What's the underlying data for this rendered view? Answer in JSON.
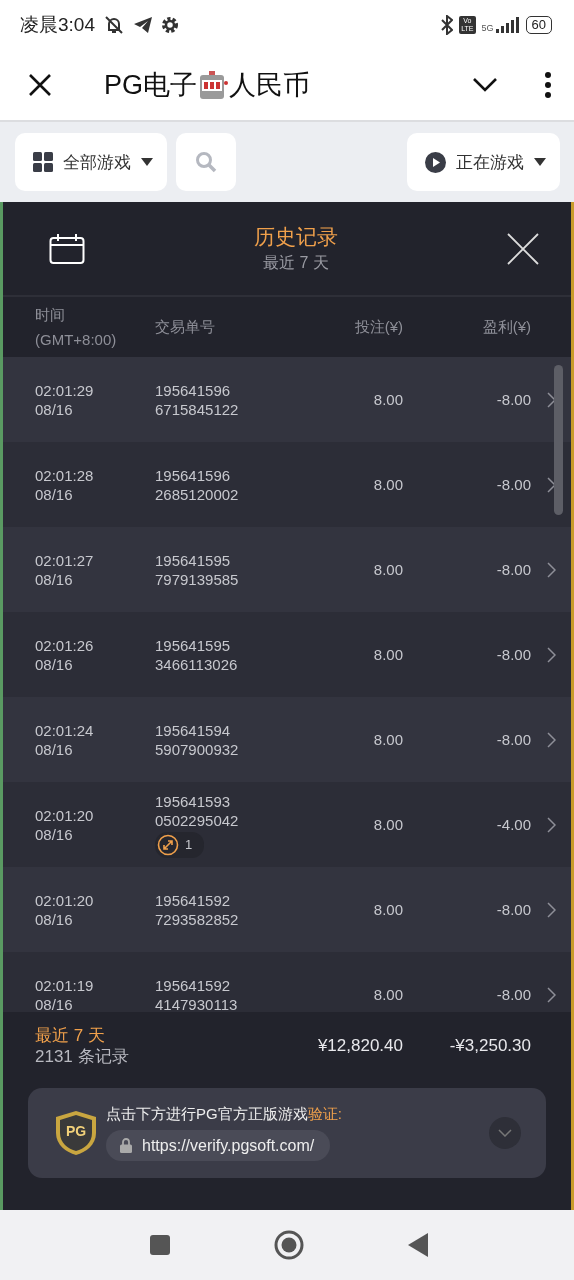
{
  "status_bar": {
    "time": "凌晨3:04",
    "volte": [
      "Vo",
      "LTE"
    ],
    "network": "5G",
    "battery": "60"
  },
  "app_bar": {
    "title_before": "PG电子",
    "title_after": "人民币"
  },
  "filters": {
    "category": "全部游戏",
    "status": "正在游戏"
  },
  "history": {
    "title": "历史记录",
    "subtitle": "最近 7 天",
    "columns": [
      "时间",
      "(GMT+8:00)",
      "交易单号",
      "投注(¥)",
      "盈利(¥)"
    ],
    "rows": [
      {
        "time": "02:01:29",
        "date": "08/16",
        "order": [
          "195641596",
          "6715845122"
        ],
        "bet": "8.00",
        "profit": "-8.00"
      },
      {
        "time": "02:01:28",
        "date": "08/16",
        "order": [
          "195641596",
          "2685120002"
        ],
        "bet": "8.00",
        "profit": "-8.00"
      },
      {
        "time": "02:01:27",
        "date": "08/16",
        "order": [
          "195641595",
          "7979139585"
        ],
        "bet": "8.00",
        "profit": "-8.00"
      },
      {
        "time": "02:01:26",
        "date": "08/16",
        "order": [
          "195641595",
          "3466113026"
        ],
        "bet": "8.00",
        "profit": "-8.00"
      },
      {
        "time": "02:01:24",
        "date": "08/16",
        "order": [
          "195641594",
          "5907900932"
        ],
        "bet": "8.00",
        "profit": "-8.00"
      },
      {
        "time": "02:01:20",
        "date": "08/16",
        "order": [
          "195641593",
          "0502295042"
        ],
        "badge": "1",
        "bet": "8.00",
        "profit": "-4.00"
      },
      {
        "time": "02:01:20",
        "date": "08/16",
        "order": [
          "195641592",
          "7293582852"
        ],
        "bet": "8.00",
        "profit": "-8.00"
      },
      {
        "time": "02:01:19",
        "date": "08/16",
        "order": [
          "195641592",
          "4147930113"
        ],
        "bet": "8.00",
        "profit": "-8.00"
      }
    ],
    "summary": {
      "period": "最近 7 天",
      "count": "2131 条记录",
      "total_bet": "¥12,820.40",
      "total_profit": "-¥3,250.30"
    }
  },
  "verify": {
    "prompt": "点击下方进行PG官方正版游戏",
    "prompt_highlight": "验证:",
    "logo": "PG",
    "url": "https://verify.pgsoft.com/"
  }
}
